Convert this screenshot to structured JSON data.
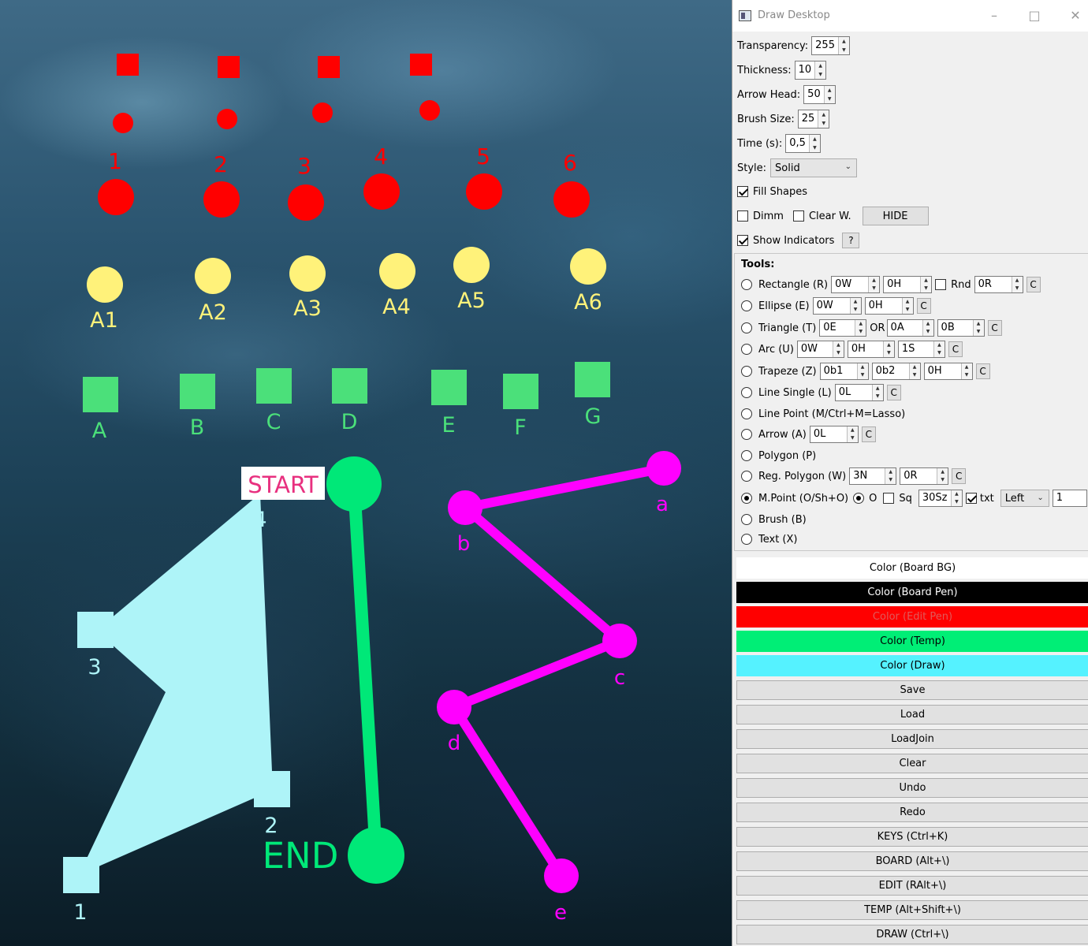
{
  "window": {
    "title": "Draw Desktop"
  },
  "settings": {
    "transparency_label": "Transparency:",
    "transparency_value": "255",
    "thickness_label": "Thickness:",
    "thickness_value": "10",
    "arrowhead_label": "Arrow Head:",
    "arrowhead_value": "50",
    "brushsize_label": "Brush Size:",
    "brushsize_value": "25",
    "time_label": "Time (s):",
    "time_value": "0,5",
    "style_label": "Style:",
    "style_value": "Solid",
    "fill_shapes_label": "Fill Shapes",
    "fill_shapes_checked": true,
    "dimm_label": "Dimm",
    "dimm_checked": false,
    "clearw_label": "Clear W.",
    "clearw_checked": false,
    "hide_button": "HIDE",
    "show_indicators_label": "Show Indicators",
    "show_indicators_checked": true,
    "help_button": "?"
  },
  "tools": {
    "title": "Tools:",
    "rectangle": {
      "label": "Rectangle (R)",
      "f1": "0W",
      "f2": "0H",
      "rnd_label": "Rnd",
      "f3": "0R",
      "c": "C"
    },
    "ellipse": {
      "label": "Ellipse (E)",
      "f1": "0W",
      "f2": "0H",
      "c": "C"
    },
    "triangle": {
      "label": "Triangle (T)",
      "f1": "0E",
      "or_label": "OR",
      "f2": "0A",
      "f3": "0B",
      "c": "C"
    },
    "arc": {
      "label": "Arc (U)",
      "f1": "0W",
      "f2": "0H",
      "f3": "1S",
      "c": "C"
    },
    "trapeze": {
      "label": "Trapeze (Z)",
      "f1": "0b1",
      "f2": "0b2",
      "f3": "0H",
      "c": "C"
    },
    "line_single": {
      "label": "Line Single (L)",
      "f1": "0L",
      "c": "C"
    },
    "line_point": {
      "label": "Line Point (M/Ctrl+M=Lasso)"
    },
    "arrow": {
      "label": "Arrow (A)",
      "f1": "0L",
      "c": "C"
    },
    "polygon": {
      "label": "Polygon (P)"
    },
    "reg_polygon": {
      "label": "Reg. Polygon (W)",
      "f1": "3N",
      "f2": "0R",
      "c": "C"
    },
    "mpoint": {
      "label": "M.Point (O/Sh+O)",
      "o_label": "O",
      "sq_label": "Sq",
      "f1": "30Sz",
      "txt_label": "txt",
      "align_value": "Left",
      "f2": "1"
    },
    "brush": {
      "label": "Brush (B)"
    },
    "text": {
      "label": "Text (X)"
    }
  },
  "colors": {
    "board_bg": {
      "label": "Color (Board BG)",
      "bg": "#ffffff",
      "fg": "#000000"
    },
    "board_pen": {
      "label": "Color (Board Pen)",
      "bg": "#000000",
      "fg": "#ffffff"
    },
    "edit_pen": {
      "label": "Color (Edit Pen)",
      "bg": "#ff0000",
      "fg": "#e05a5a"
    },
    "temp": {
      "label": "Color (Temp)",
      "bg": "#00ee76",
      "fg": "#000000"
    },
    "draw": {
      "label": "Color (Draw)",
      "bg": "#55f2ff",
      "fg": "#000000"
    }
  },
  "actions": [
    "Save",
    "Load",
    "LoadJoin",
    "Clear",
    "Undo",
    "Redo",
    "KEYS (Ctrl+K)",
    "BOARD (Alt+\\)",
    "EDIT (RAlt+\\)",
    "TEMP (Alt+Shift+\\)",
    "DRAW (Ctrl+\\)"
  ],
  "canvas": {
    "red_numbers": [
      "1",
      "2",
      "3",
      "4",
      "5",
      "6"
    ],
    "yellow_labels": [
      "A1",
      "A2",
      "A3",
      "A4",
      "A5",
      "A6"
    ],
    "green_labels": [
      "A",
      "B",
      "C",
      "D",
      "E",
      "F",
      "G"
    ],
    "start_label": "START",
    "end_label": "END",
    "cyan_labels": [
      "4",
      "3",
      "2",
      "1"
    ],
    "magenta_labels": [
      "a",
      "b",
      "c",
      "d",
      "e"
    ],
    "palette": {
      "red": "#ff0000",
      "yellow": "#fff27a",
      "green": "#4be07a",
      "mint": "#00e878",
      "cyan": "#aef4f8",
      "magenta": "#ff00ff"
    }
  }
}
